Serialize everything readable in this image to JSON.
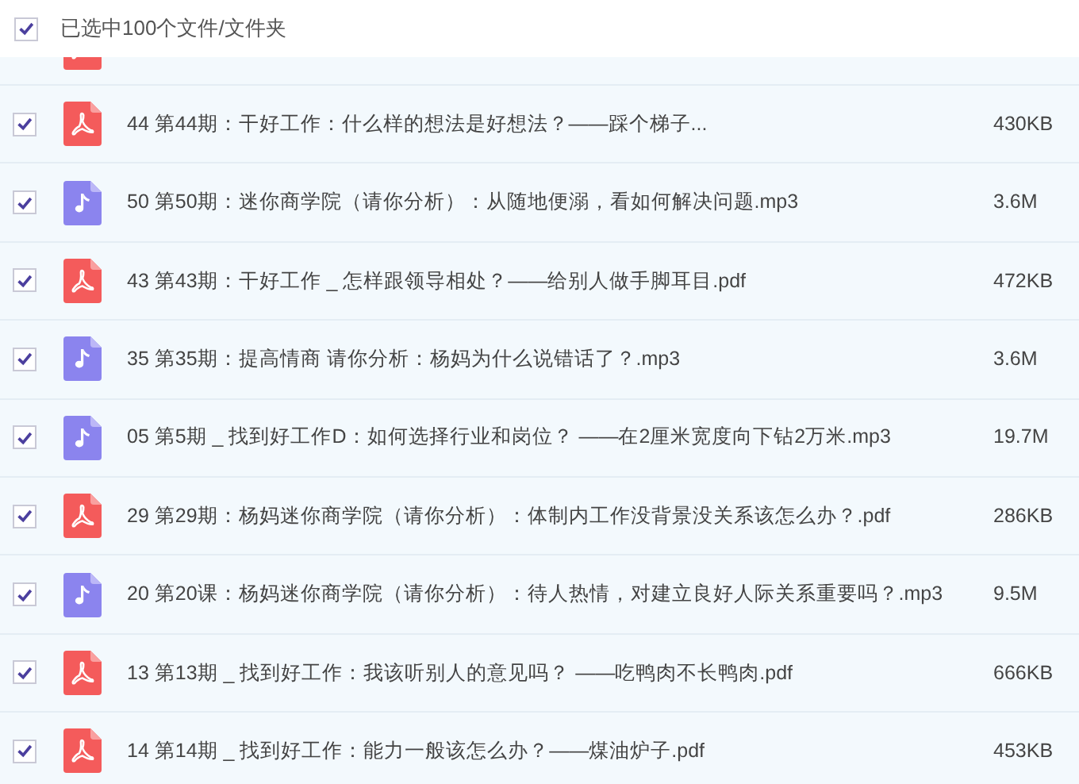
{
  "header": {
    "checked": true,
    "label": "已选中100个文件/文件夹"
  },
  "partial_file": {
    "kind": "pdf"
  },
  "files": [
    {
      "kind": "pdf",
      "checked": true,
      "name": "44 第44期：干好工作：什么样的想法是好想法？——踩个梯子...",
      "size": "430KB"
    },
    {
      "kind": "audio",
      "checked": true,
      "name": "50 第50期：迷你商学院（请你分析）：从随地便溺，看如何解决问题.mp3",
      "size": "3.6M"
    },
    {
      "kind": "pdf",
      "checked": true,
      "name": "43 第43期：干好工作 _ 怎样跟领导相处？——给别人做手脚耳目.pdf",
      "size": "472KB"
    },
    {
      "kind": "audio",
      "checked": true,
      "name": "35 第35期：提高情商 请你分析：杨妈为什么说错话了？.mp3",
      "size": "3.6M"
    },
    {
      "kind": "audio",
      "checked": true,
      "name": "05 第5期 _ 找到好工作D：如何选择行业和岗位？ ——在2厘米宽度向下钻2万米.mp3",
      "size": "19.7M"
    },
    {
      "kind": "pdf",
      "checked": true,
      "name": "29 第29期：杨妈迷你商学院（请你分析）：体制内工作没背景没关系该怎么办？.pdf",
      "size": "286KB"
    },
    {
      "kind": "audio",
      "checked": true,
      "name": "20 第20课：杨妈迷你商学院（请你分析）：待人热情，对建立良好人际关系重要吗？.mp3",
      "size": "9.5M"
    },
    {
      "kind": "pdf",
      "checked": true,
      "name": "13 第13期 _ 找到好工作：我该听别人的意见吗？ ——吃鸭肉不长鸭肉.pdf",
      "size": "666KB"
    },
    {
      "kind": "pdf",
      "checked": true,
      "name": "14 第14期 _ 找到好工作：能力一般该怎么办？——煤油炉子.pdf",
      "size": "453KB"
    }
  ]
}
